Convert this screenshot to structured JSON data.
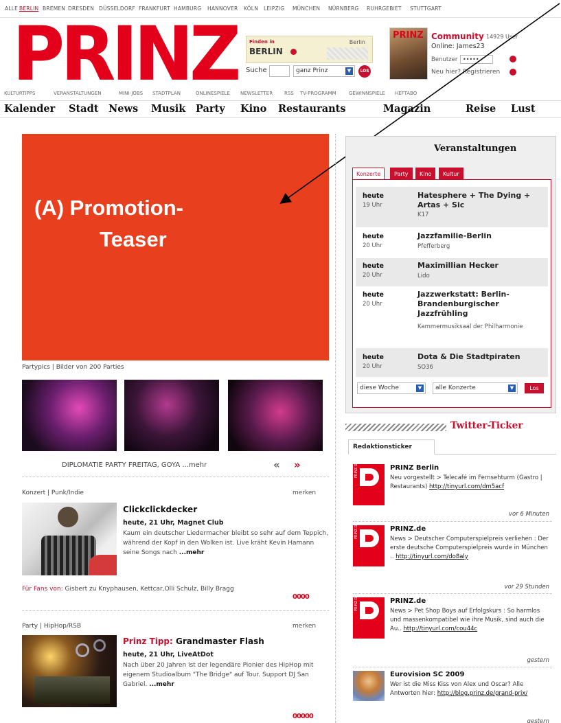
{
  "cities": [
    {
      "label": "ALLE",
      "active": false
    },
    {
      "label": "BERLIN",
      "active": true
    },
    {
      "label": "BREMEN",
      "active": false
    },
    {
      "label": "DRESDEN",
      "active": false
    },
    {
      "label": "DÜSSELDORF",
      "active": false
    },
    {
      "label": "FRANKFURT",
      "active": false
    },
    {
      "label": "HAMBURG",
      "active": false
    },
    {
      "label": "HANNOVER",
      "active": false
    },
    {
      "label": "KÖLN",
      "active": false
    },
    {
      "label": "LEIPZIG",
      "active": false
    },
    {
      "label": "MÜNCHEN",
      "active": false
    },
    {
      "label": "NÜRNBERG",
      "active": false
    },
    {
      "label": "RUHRGEBIET",
      "active": false
    },
    {
      "label": "STUTTGART",
      "active": false
    }
  ],
  "logo": "PRINZ",
  "finden": {
    "line1": "Finden in",
    "line1b": "Berlin",
    "city": "BERLIN",
    "sub": "Berlin"
  },
  "search": {
    "label": "Suche",
    "scope": "ganz Prinz",
    "go": "LOS"
  },
  "community": {
    "title": "Community",
    "count": "14929 User",
    "online": "Online: James23",
    "user_label": "Benutzer",
    "password_mask": "•••••",
    "register": "Neu hier? Registrieren"
  },
  "service_nav": [
    "KULTURTIPPS",
    "VERANSTALTUNGEN",
    "MINI-JOBS",
    "STADTPLAN",
    "ONLINESPIELE",
    "NEWSLETTER",
    "RSS",
    "TV-PROGRAMM",
    "GEWINNSPIELE",
    "HEFTABO"
  ],
  "main_nav": [
    "Kalender",
    "Stadt",
    "News",
    "Musik",
    "Party",
    "Kino",
    "Restaurants",
    "Magazin",
    "Reise",
    "Lust"
  ],
  "promo": {
    "line1": "(A) Promotion-",
    "line2": "Teaser"
  },
  "partypics": {
    "label": "Partypics | Bilder von 200 Parties",
    "caption": "DIPLOMATIE PARTY FREITAG, GOYA ...mehr",
    "prev": "«",
    "next": "»"
  },
  "article1": {
    "category": "Konzert | Punk/Indie",
    "merken": "merken",
    "title": "Clickclickdecker",
    "meta": "heute, 21 Uhr, Magnet Club",
    "text": "Kaum ein deutscher Liedermacher bleibt so sehr auf dem Teppich, während der Kopf in den Wolken ist. Live kräht Kevin Hamann seine Songs nach ",
    "more": "...mehr",
    "fans_label": "Für Fans von:",
    "fans": " Gisbert zu Knyphausen, Kettcar,Olli Schulz, Billy Bragg",
    "rating": "0000"
  },
  "article2": {
    "category": "Party | HipHop/RSB",
    "merken": "merken",
    "tipp": "Prinz Tipp:",
    "title": " Grandmaster Flash",
    "meta": "heute, 21 Uhr, LiveAtDot",
    "text": "Nach über 20 Jahren ist der legendäre Pionier des HipHop mit eigenem Studioalbum \"The Bridge\" auf Tour. Support DJ San Gabriel. ",
    "more": "...mehr",
    "rating": "00000"
  },
  "veranstaltungen": {
    "title": "Veranstaltungen",
    "tabs": [
      "Konzerte",
      "Party",
      "Kino",
      "Kultur"
    ],
    "events": [
      {
        "day": "heute",
        "time": "19 Uhr",
        "name": "Hatesphere + The Dying + Artas + Sic",
        "location": "K17"
      },
      {
        "day": "heute",
        "time": "20 Uhr",
        "name": "Jazzfamilie-Berlin",
        "location": "Pfefferberg"
      },
      {
        "day": "heute",
        "time": "20 Uhr",
        "name": "Maximillian Hecker",
        "location": "Lido"
      },
      {
        "day": "heute",
        "time": "20 Uhr",
        "name": "Jazzwerkstatt: Berlin-Brandenburgischer Jazzfrühling",
        "location": "Kammermusiksaal der Philharmonie"
      },
      {
        "day": "heute",
        "time": "20 Uhr",
        "name": "Dota & Die Stadtpiraten",
        "location": "SO36"
      }
    ],
    "week": "diese Woche",
    "all": "alle Konzerte",
    "go": "Los"
  },
  "twitter": {
    "title": "Twitter-Ticker",
    "tab": "Redaktionsticker",
    "items": [
      {
        "who": "PRINZ Berlin",
        "text": "Neu vorgestellt > Telecafé im Fernsehturm (Gastro | Restaurants) ",
        "url": "http://tinyurl.com/dm5acf",
        "ago": "vor 6 Minuten"
      },
      {
        "who": "PRINZ.de",
        "text": "News > Deutscher Computerspielpreis verliehen : Der erste deutsche Computerspielpreis wurde in München .. ",
        "url": "http://tinyurl.com/do8aly",
        "ago": "vor 29 Stunden"
      },
      {
        "who": "PRINZ.de",
        "text": "News > Pet Shop Boys auf Erfolgskurs : So harmlos und massenkompatibel wie ihre Musik, sind auch die Au.. ",
        "url": "http://tinyurl.com/cou44c",
        "ago": "gestern"
      },
      {
        "who": "Eurovision SC 2009",
        "text": "Wer ist die Miss Kiss von Alex und Oscar? Alle Antworten hier: ",
        "url": "http://blog.prinz.de/grand-prix/",
        "ago": "gestern"
      }
    ],
    "logo_text": "PRINZ.DE"
  }
}
